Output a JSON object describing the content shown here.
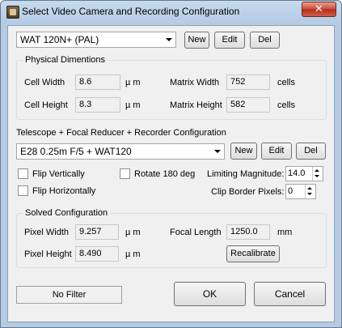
{
  "window": {
    "title": "Select Video Camera and Recording Configuration",
    "close_label": "✕"
  },
  "camera": {
    "selected": "WAT 120N+ (PAL)",
    "new_label": "New",
    "edit_label": "Edit",
    "del_label": "Del"
  },
  "physical": {
    "title": "Physical Dimentions",
    "cell_width_label": "Cell Width",
    "cell_width_value": "8.6",
    "cell_height_label": "Cell Height",
    "cell_height_value": "8.3",
    "micron_unit": "µ m",
    "matrix_width_label": "Matrix Width",
    "matrix_width_value": "752",
    "matrix_height_label": "Matrix Height",
    "matrix_height_value": "582",
    "cells_unit": "cells"
  },
  "config": {
    "title": "Telescope + Focal Reducer + Recorder Configuration",
    "selected": "E28 0.25m F/5 + WAT120",
    "new_label": "New",
    "edit_label": "Edit",
    "del_label": "Del"
  },
  "options": {
    "flip_vertically": "Flip Vertically",
    "flip_horizontally": "Flip Horizontally",
    "rotate_180": "Rotate 180 deg",
    "limiting_magnitude_label": "Limiting Magnitude:",
    "limiting_magnitude_value": "14.0",
    "clip_border_label": "Clip Border Pixels:",
    "clip_border_value": "0"
  },
  "solved": {
    "title": "Solved Configuration",
    "pixel_width_label": "Pixel Width",
    "pixel_width_value": "9.257",
    "pixel_height_label": "Pixel Height",
    "pixel_height_value": "8.490",
    "micron_unit": "µ m",
    "focal_length_label": "Focal Length",
    "focal_length_value": "1250.0",
    "focal_unit": "mm",
    "recalibrate_label": "Recalibrate"
  },
  "footer": {
    "filter_label": "No Filter",
    "ok_label": "OK",
    "cancel_label": "Cancel"
  }
}
